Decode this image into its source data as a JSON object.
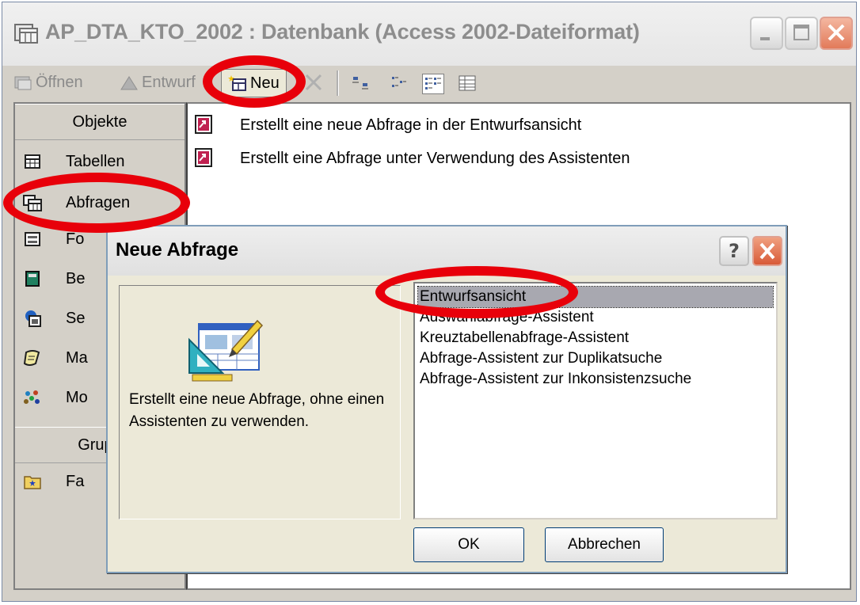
{
  "window": {
    "title": "AP_DTA_KTO_2002 : Datenbank (Access 2002-Dateiformat)"
  },
  "toolbar": {
    "open_label": "Öffnen",
    "design_label": "Entwurf",
    "new_label": "Neu"
  },
  "sidebar": {
    "objects_header": "Objekte",
    "items": [
      {
        "label": "Tabellen",
        "icon": "table-icon"
      },
      {
        "label": "Abfragen",
        "icon": "query-icon"
      },
      {
        "label": "Fo",
        "icon": "form-icon"
      },
      {
        "label": "Be",
        "icon": "report-icon"
      },
      {
        "label": "Se",
        "icon": "page-icon"
      },
      {
        "label": "Ma",
        "icon": "macro-icon"
      },
      {
        "label": "Mo",
        "icon": "module-icon"
      }
    ],
    "groups_header": "Grupp",
    "group_items": [
      {
        "label": "Fa",
        "icon": "favorites-icon"
      }
    ]
  },
  "list": {
    "items": [
      {
        "label": "Erstellt eine neue Abfrage in der Entwurfsansicht"
      },
      {
        "label": "Erstellt eine Abfrage unter Verwendung des Assistenten"
      }
    ]
  },
  "dialog": {
    "title": "Neue Abfrage",
    "help_label": "?",
    "description": "Erstellt eine neue Abfrage, ohne einen Assistenten zu verwenden.",
    "options": [
      "Entwurfsansicht",
      "Auswahlabfrage-Assistent",
      "Kreuztabellenabfrage-Assistent",
      "Abfrage-Assistent zur Duplikatsuche",
      "Abfrage-Assistent zur Inkonsistenzsuche"
    ],
    "selected_option": "Entwurfsansicht",
    "ok_label": "OK",
    "cancel_label": "Abbrechen"
  },
  "colors": {
    "highlight": "#e8000a",
    "face": "#d4d0c8",
    "selection": "#a8a8b0"
  }
}
